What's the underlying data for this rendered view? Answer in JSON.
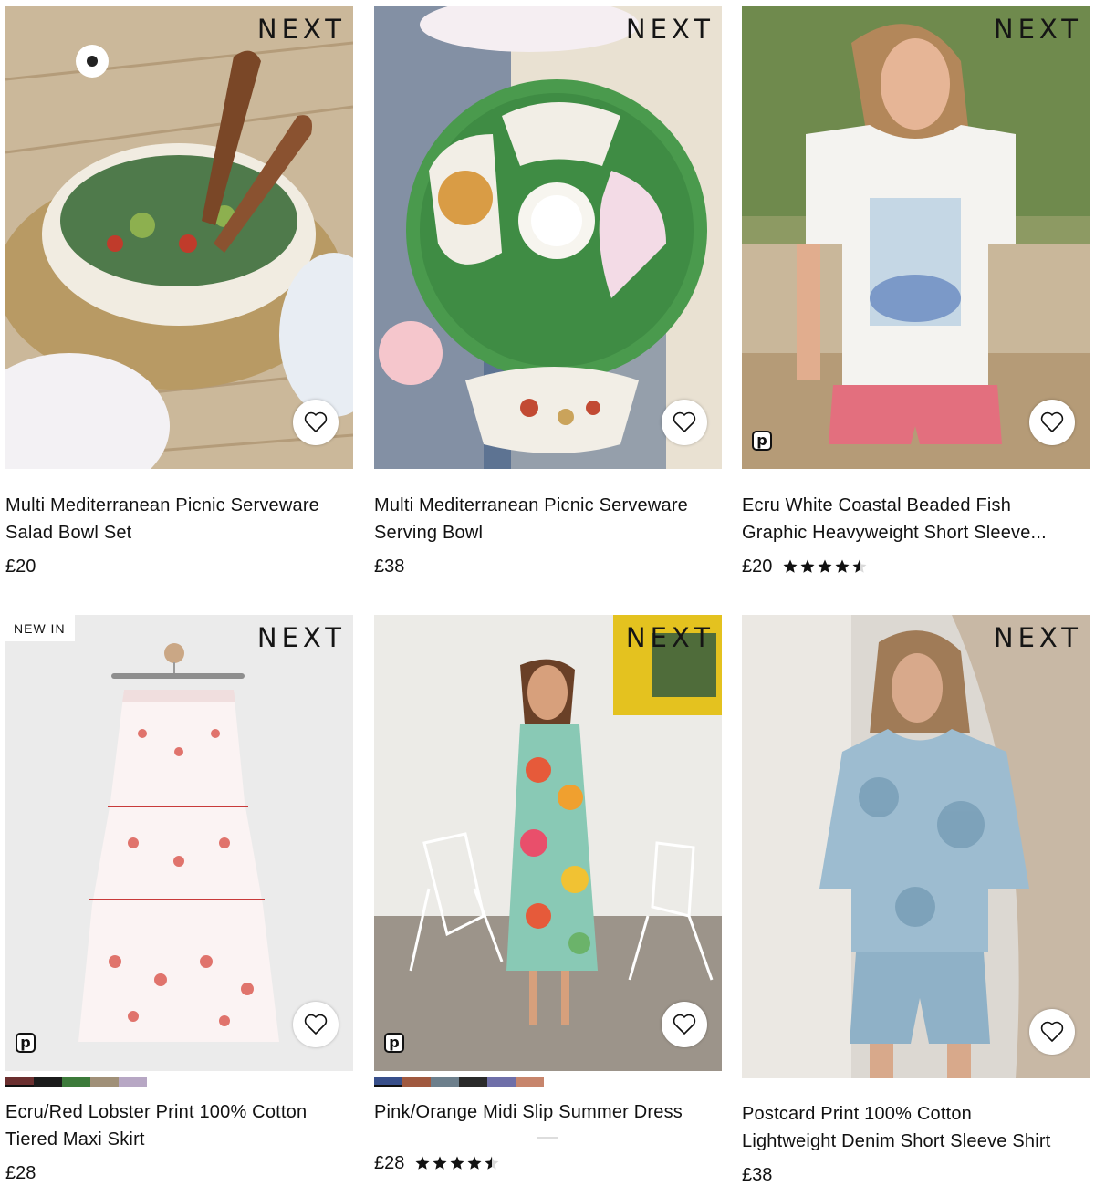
{
  "brand": "NEXT",
  "badges": {
    "new_in": "NEW IN",
    "pay_letter": "p"
  },
  "products": [
    {
      "title_line1": "Multi Mediterranean Picnic Serveware",
      "title_line2": "Salad Bowl Set",
      "price": "£20"
    },
    {
      "title_line1": "Multi Mediterranean Picnic Serveware",
      "title_line2": "Serving Bowl",
      "price": "£38"
    },
    {
      "title_line1": "Ecru White Coastal Beaded Fish",
      "title_line2": "Graphic Heavyweight Short Sleeve...",
      "price": "£20",
      "rating": 4.5
    },
    {
      "title_line1": "Ecru/Red Lobster Print 100% Cotton",
      "title_line2": "Tiered Maxi Skirt",
      "price": "£28",
      "swatch_colors": [
        "#6b2f2f",
        "#1b1b1b",
        "#3c7a3a",
        "#a09078",
        "#b7a7c4"
      ]
    },
    {
      "title_line1": "Pink/Orange Midi Slip Summer Dress",
      "title_line2": "",
      "price": "£28",
      "rating": 4.5,
      "swatch_colors": [
        "#384f8a",
        "#a0593f",
        "#6d7f8c",
        "#2a2a2a",
        "#6f6fa8",
        "#c7856c"
      ]
    },
    {
      "title_line1": "Postcard Print 100% Cotton",
      "title_line2": "Lightweight Denim Short Sleeve Shirt",
      "price": "£38"
    }
  ],
  "colors": {
    "text": "#111111",
    "star": "#111111",
    "heart_bg": "#ffffff"
  },
  "icons": {
    "favourite": "heart-outline-icon",
    "rating": "star-icon",
    "pay": "p-badge-icon"
  }
}
